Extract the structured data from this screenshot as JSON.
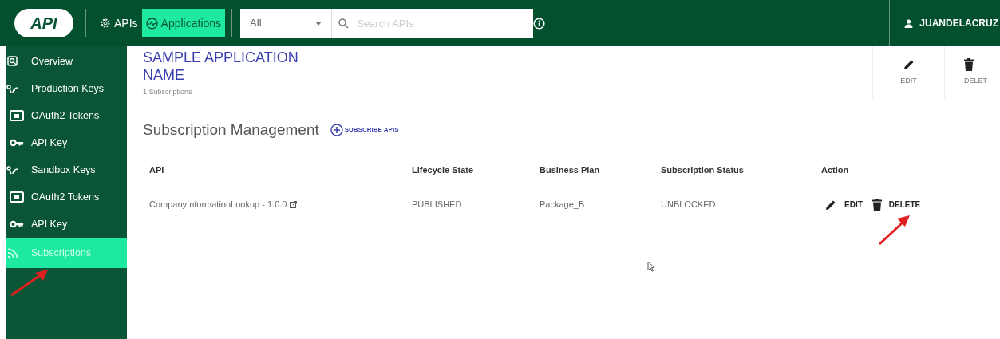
{
  "topbar": {
    "logo": "API",
    "nav": [
      {
        "label": "APIs",
        "kind": "gear",
        "selected": false
      },
      {
        "label": "Applications",
        "kind": "apps",
        "selected": true
      }
    ],
    "filter": {
      "value": "All"
    },
    "search": {
      "placeholder": "Search APIs"
    },
    "user": "JUANDELACRUZ"
  },
  "sidebar": {
    "items": [
      {
        "label": "Overview",
        "kind": "overview",
        "selected": false
      },
      {
        "label": "Production Keys",
        "kind": "keys",
        "selected": false,
        "children": [
          {
            "label": "OAuth2 Tokens",
            "kind": "token",
            "selected": false
          },
          {
            "label": "API Key",
            "kind": "key",
            "selected": false
          }
        ]
      },
      {
        "label": "Sandbox Keys",
        "kind": "keys",
        "selected": false,
        "children": [
          {
            "label": "OAuth2 Tokens",
            "kind": "token",
            "selected": false
          },
          {
            "label": "API Key",
            "kind": "key",
            "selected": false
          }
        ]
      },
      {
        "label": "Subscriptions",
        "kind": "subs",
        "selected": true
      }
    ]
  },
  "header": {
    "title": "SAMPLE APPLICATION NAME",
    "subtitle": "1 Subscriptions",
    "actions": [
      {
        "label": "EDIT",
        "kind": "edit"
      },
      {
        "label": "DELET",
        "kind": "delete"
      }
    ]
  },
  "section": {
    "title": "Subscription Management",
    "button": "SUBSCRIBE APIS"
  },
  "table": {
    "columns": [
      "API",
      "Lifecycle State",
      "Business Plan",
      "Subscription Status",
      "Action"
    ],
    "rows": [
      {
        "api": "CompanyInformationLookup - 1.0.0",
        "lifecycle": "PUBLISHED",
        "plan": "Package_B",
        "status": "UNBLOCKED",
        "actions": [
          {
            "label": "EDIT",
            "kind": "edit"
          },
          {
            "label": "DELETE",
            "kind": "delete"
          }
        ]
      }
    ]
  }
}
